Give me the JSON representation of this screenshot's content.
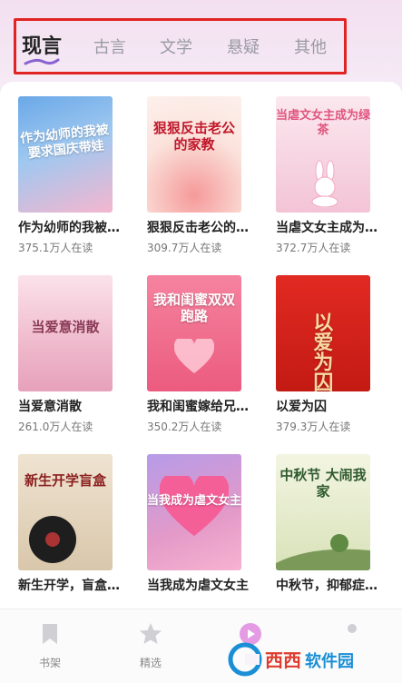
{
  "tabs": [
    {
      "label": "现言",
      "active": true
    },
    {
      "label": "古言",
      "active": false
    },
    {
      "label": "文学",
      "active": false
    },
    {
      "label": "悬疑",
      "active": false
    },
    {
      "label": "其他",
      "active": false
    }
  ],
  "books": [
    {
      "title": "作为幼师的我被…",
      "readers": "375.1万人在读",
      "cover_text": "作为幼师的我被要求国庆带娃",
      "cover_colors": [
        "#7fb7ea",
        "#f2a9c6"
      ]
    },
    {
      "title": "狠狠反击老公的…",
      "readers": "309.7万人在读",
      "cover_text": "狠狠反击老公的家教",
      "cover_colors": [
        "#fbe3dc",
        "#f7c8c0"
      ]
    },
    {
      "title": "当虐文女主成为…",
      "readers": "372.7万人在读",
      "cover_text": "当虐文女主成为绿茶",
      "cover_colors": [
        "#f8dbe6",
        "#f4c6d8"
      ]
    },
    {
      "title": "当爱意消散",
      "readers": "261.0万人在读",
      "cover_text": "当爱意消散",
      "cover_colors": [
        "#f6cfdc",
        "#eab3c8"
      ]
    },
    {
      "title": "我和闺蜜嫁给兄…",
      "readers": "350.2万人在读",
      "cover_text": "我和闺蜜双双跑路",
      "cover_colors": [
        "#f17b9a",
        "#e84a74"
      ]
    },
    {
      "title": "以爱为囚",
      "readers": "379.3万人在读",
      "cover_text": "以爱为囚",
      "cover_colors": [
        "#d6261e",
        "#b31511"
      ]
    },
    {
      "title": "新生开学，盲盒…",
      "readers": "",
      "cover_text": "新生开学盲盒",
      "cover_colors": [
        "#e9dcc8",
        "#c9b79c"
      ]
    },
    {
      "title": "当我成为虐文女主",
      "readers": "",
      "cover_text": "当我成为虐文女主",
      "cover_colors": [
        "#c9a8ef",
        "#f096c3"
      ]
    },
    {
      "title": "中秋节，抑郁症…",
      "readers": "",
      "cover_text": "中秋节 大闹我家",
      "cover_colors": [
        "#eef0d6",
        "#c9d6a8"
      ]
    }
  ],
  "nav": [
    {
      "label": "书架",
      "icon": "bookmark-icon"
    },
    {
      "label": "精选",
      "icon": "star-icon"
    },
    {
      "label": "",
      "icon": "play-icon"
    },
    {
      "label": "",
      "icon": "profile-icon"
    }
  ],
  "watermark": "西西软件园",
  "colors": {
    "annotation": "#e02323",
    "tab_active": "#222222",
    "tab_inactive": "#9a9aa2"
  }
}
